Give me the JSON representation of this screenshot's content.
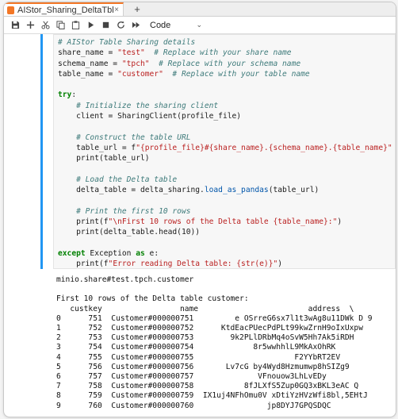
{
  "tab": {
    "title": "AIStor_Sharing_DeltaTbl.ipynb",
    "close": "×",
    "new": "+"
  },
  "toolbar": {
    "buttons": [
      "save-icon",
      "add-icon",
      "cut-icon",
      "copy-icon",
      "paste-icon",
      "run-icon",
      "stop-icon",
      "restart-icon",
      "fast-forward-icon"
    ],
    "cell_type": "Code"
  },
  "code": {
    "c1": "# AIStor Table Sharing details",
    "l_share_a": "share_name = ",
    "l_share_s": "\"test\"",
    "l_share_c": "  # Replace with your share name",
    "l_schema_a": "schema_name = ",
    "l_schema_s": "\"tpch\"",
    "l_schema_c": "  # Replace with your schema name",
    "l_table_a": "table_name = ",
    "l_table_s": "\"customer\"",
    "l_table_c": "  # Replace with your table name",
    "try_kw": "try",
    "c2": "# Initialize the sharing client",
    "client_a": "client = SharingClient(profile_file)",
    "c3": "# Construct the table URL",
    "url_a": "table_url = f",
    "url_s": "\"{profile_file}#{share_name}.{schema_name}.{table_name}\"",
    "print_url": "print(table_url)",
    "c4": "# Load the Delta table",
    "delta_a": "delta_table = delta_sharing.",
    "delta_fn": "load_as_pandas",
    "delta_b": "(table_url)",
    "c5": "# Print the first 10 rows",
    "pr1_a": "print(f",
    "pr1_s": "\"\\nFirst 10 rows of the Delta table {table_name}:\"",
    "pr1_b": ")",
    "pr2": "print(delta_table.head(10))",
    "except_kw": "except",
    "except_a": " Exception ",
    "as_kw": "as",
    "except_b": " e:",
    "pr3_a": "print(f",
    "pr3_s": "\"Error reading Delta table: {str(e)}\"",
    "pr3_b": ")"
  },
  "output": {
    "line1": "minio.share#test.tpch.customer",
    "line2": "First 10 rows of the Delta table customer:",
    "header": "   custkey                 name                        address  \\",
    "rows": [
      "0      751  Customer#000000751         e OSrreG6sx7l1t3wAg8u11DWk D 9",
      "1      752  Customer#000000752      KtdEacPUecPdPLt99kwZrnH9oIxUxpw",
      "2      753  Customer#000000753        9k2PLlDRbMq4oSvW5Hh7Ak5iRDH",
      "3      754  Customer#000000754             8r5wwhhlL9MkAxOhRK",
      "4      755  Customer#000000755                      F2YYbRT2EV",
      "5      756  Customer#000000756       Lv7cG by4Wyd8Hzmumwp8hSIZg9",
      "6      757  Customer#000000757              VFnouow3LhLvEDy",
      "7      758  Customer#000000758           8fJLXfS5Zup0GQ3xBKL3eAC Q",
      "8      759  Customer#000000759  IX1uj4NFhOmu0V xDtiYzHVzWfi8bl,5EHtJ",
      "9      760  Customer#000000760                jp8DYJ7GPQSDQC"
    ]
  }
}
